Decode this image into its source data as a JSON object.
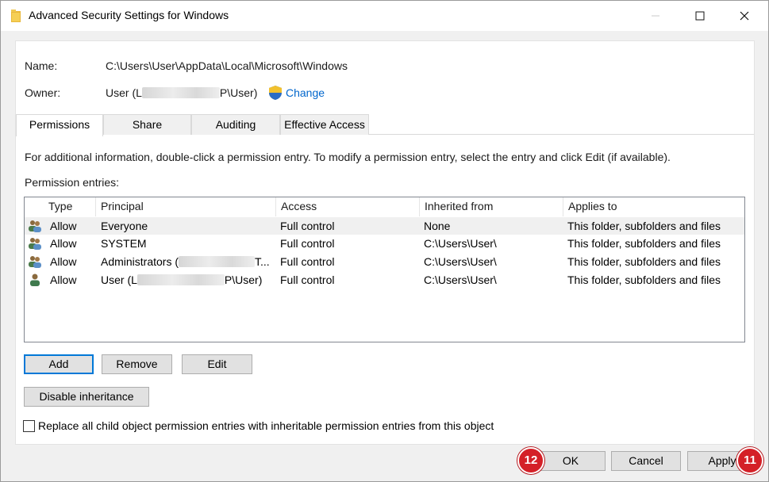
{
  "window": {
    "title": "Advanced Security Settings for Windows"
  },
  "object": {
    "name_label": "Name:",
    "name_value": "C:\\Users\\User\\AppData\\Local\\Microsoft\\Windows",
    "owner_label": "Owner:",
    "owner_prefix": "User (L",
    "owner_suffix": "P\\User)",
    "change_link": "Change"
  },
  "tabs": [
    {
      "label": "Permissions",
      "active": true
    },
    {
      "label": "Share",
      "active": false
    },
    {
      "label": "Auditing",
      "active": false
    },
    {
      "label": "Effective Access",
      "active": false
    }
  ],
  "info_text": "For additional information, double-click a permission entry. To modify a permission entry, select the entry and click Edit (if available).",
  "entries_label": "Permission entries:",
  "columns": [
    "Type",
    "Principal",
    "Access",
    "Inherited from",
    "Applies to"
  ],
  "rows": [
    {
      "icon": "group-users-icon",
      "type": "Allow",
      "principal": "Everyone",
      "principal_suffix": "",
      "access": "Full control",
      "inherited": "None",
      "applies": "This folder, subfolders and files"
    },
    {
      "icon": "group-users-icon",
      "type": "Allow",
      "principal": "SYSTEM",
      "principal_suffix": "",
      "access": "Full control",
      "inherited": "C:\\Users\\User\\",
      "applies": "This folder, subfolders and files"
    },
    {
      "icon": "group-users-icon",
      "type": "Allow",
      "principal": "Administrators (",
      "principal_suffix": "T...",
      "access": "Full control",
      "inherited": "C:\\Users\\User\\",
      "applies": "This folder, subfolders and files"
    },
    {
      "icon": "single-user-icon",
      "type": "Allow",
      "principal": "User (L",
      "principal_suffix": "P\\User)",
      "access": "Full control",
      "inherited": "C:\\Users\\User\\",
      "applies": "This folder, subfolders and files"
    }
  ],
  "buttons": {
    "add": "Add",
    "remove": "Remove",
    "edit": "Edit",
    "disable_inheritance": "Disable inheritance",
    "ok": "OK",
    "cancel": "Cancel",
    "apply": "Apply"
  },
  "replace_checkbox": {
    "label": "Replace all child object permission entries with inheritable permission entries from this object",
    "checked": false
  },
  "annotations": {
    "badge_ok": "12",
    "badge_apply": "11"
  },
  "colors": {
    "link": "#0066cc",
    "badge": "#d42027",
    "default_button_border": "#0078d7"
  }
}
